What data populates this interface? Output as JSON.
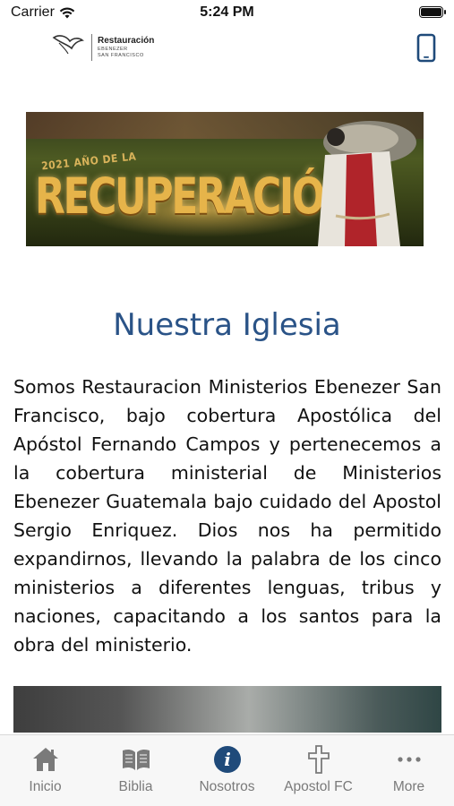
{
  "status_bar": {
    "carrier": "Carrier",
    "time": "5:24 PM",
    "battery_level": 1.0
  },
  "header": {
    "logo": {
      "title": "Restauración",
      "subtitle_line1": "EBENEZER",
      "subtitle_line2": "SAN FRANCISCO",
      "mark_text": "Ebenezer"
    },
    "phone_icon": "phone-icon"
  },
  "banner": {
    "year_text": "2021 AÑO DE LA",
    "title_text": "RECUPERACIÓN"
  },
  "section": {
    "title": "Nuestra Iglesia",
    "body": "Somos Restauracion Ministerios Ebenezer San Francisco, bajo cobertura Apostólica del Apóstol Fernando Campos y pertenecemos a la cobertura ministerial de Ministerios Ebenezer Guatemala bajo cuidado del Apostol Sergio Enriquez. Dios nos ha permitido expandirnos, llevando la palabra de los cinco ministerios a diferentes lenguas, tribus y naciones, capacitando a los santos para la obra del ministerio."
  },
  "tabs": [
    {
      "label": "Inicio",
      "icon": "home-icon",
      "active": false
    },
    {
      "label": "Biblia",
      "icon": "book-icon",
      "active": false
    },
    {
      "label": "Nosotros",
      "icon": "info-icon",
      "active": true
    },
    {
      "label": "Apostol FC",
      "icon": "cross-icon",
      "active": false
    },
    {
      "label": "More",
      "icon": "more-icon",
      "active": false
    }
  ],
  "colors": {
    "accent": "#2a5387",
    "tab_icon": "#7a7a7a",
    "active_tab_icon": "#1f4a7a"
  }
}
